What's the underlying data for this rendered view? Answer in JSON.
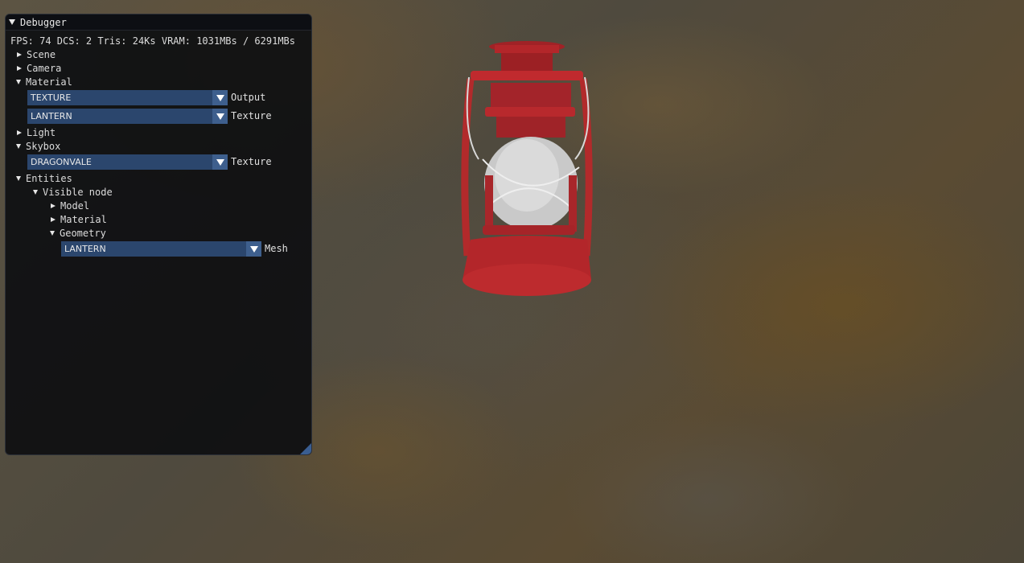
{
  "window": {
    "title": "Debugger",
    "stats": "FPS: 74 DCS: 2 Tris: 24Ks  VRAM: 1031MBs / 6291MBs"
  },
  "tree": {
    "scene": "Scene",
    "camera": "Camera",
    "material": {
      "label": "Material",
      "output_value": "TEXTURE",
      "output_label": "Output",
      "texture_value": "LANTERN",
      "texture_label": "Texture"
    },
    "light": "Light",
    "skybox": {
      "label": "Skybox",
      "texture_value": "DRAGONVALE",
      "texture_label": "Texture"
    },
    "entities": {
      "label": "Entities",
      "visible_node": "Visible node",
      "model": "Model",
      "material": "Material",
      "geometry": "Geometry",
      "mesh_value": "LANTERN",
      "mesh_label": "Mesh"
    }
  },
  "colors": {
    "panel_bg": "#0f1012",
    "combo_bg": "#2b466d",
    "combo_button": "#3e5f8d",
    "lantern_red": "#b3262a"
  },
  "icons": [
    "collapse-arrow-icon",
    "expand-arrow-icon",
    "dropdown-arrow-icon",
    "resize-grip-icon"
  ]
}
